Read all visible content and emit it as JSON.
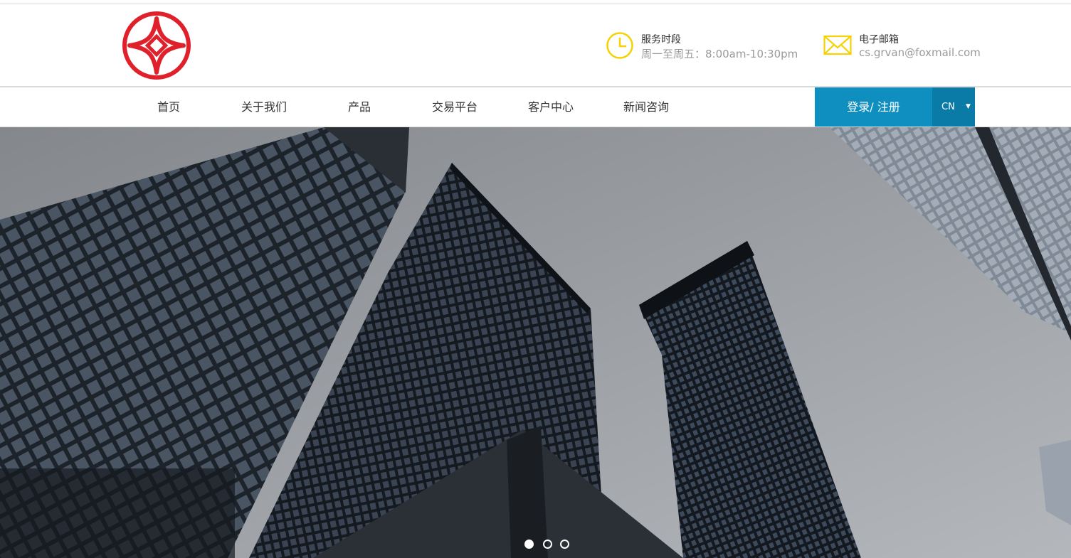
{
  "header": {
    "hours": {
      "title": "服务时段",
      "value": "周一至周五：8:00am-10:30pm",
      "icon": "clock-icon"
    },
    "email": {
      "title": "电子邮箱",
      "value": "cs.grvan@foxmail.com",
      "icon": "mail-icon"
    }
  },
  "nav": {
    "items": [
      {
        "label": "首页"
      },
      {
        "label": "关于我们"
      },
      {
        "label": "产品"
      },
      {
        "label": "交易平台"
      },
      {
        "label": "客户中心"
      },
      {
        "label": "新闻咨询"
      }
    ],
    "login_label": "登录/ 注册",
    "language": "CN"
  },
  "carousel": {
    "slide_count": 3,
    "active_index": 0
  },
  "colors": {
    "brand_red": "#e0202a",
    "accent_yellow": "#f5d200",
    "login_blue": "#0f8fbf",
    "lang_blue": "#0a7aa6"
  }
}
